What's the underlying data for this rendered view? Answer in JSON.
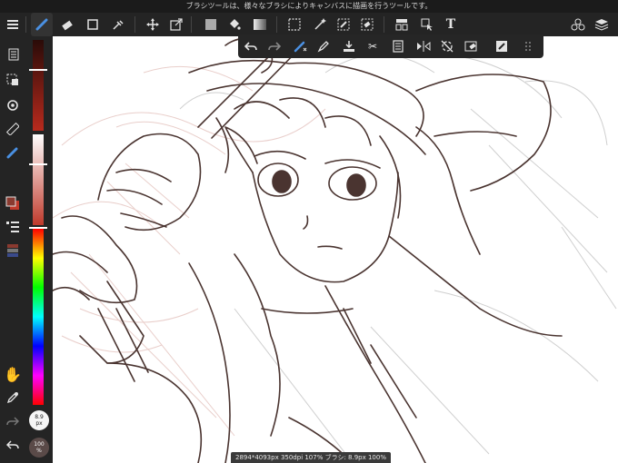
{
  "hint_text": "ブラシツールは、様々なブラシによりキャンバスに描画を行うツールです。",
  "colors": {
    "primary": "#8a3a30",
    "secondary": "#c0392b",
    "toolbar_bg": "#242424",
    "accent": "#4a90e2"
  },
  "toolbar": {
    "items": [
      "menu-icon",
      "brush-icon",
      "eraser-icon",
      "shape-icon",
      "smudge-icon",
      "move-icon",
      "transform-icon",
      "fill-color-icon",
      "bucket-icon",
      "gradient-icon",
      "select-icon",
      "magic-wand-icon",
      "select-pen-icon",
      "select-eraser-icon",
      "frame-icon",
      "operation-icon",
      "text-icon",
      "materials-icon",
      "layers-icon"
    ]
  },
  "sub_toolbar": {
    "items": [
      "undo-icon",
      "redo-icon",
      "brush-adjust-icon",
      "pen-icon",
      "paste-icon",
      "cut-icon",
      "copy-icon",
      "flip-icon",
      "rotate-icon",
      "clear-icon",
      "edit-icon",
      "grip-icon"
    ]
  },
  "left_panel": {
    "brush_size": "8.9",
    "brush_size_unit": "px",
    "opacity": "100",
    "opacity_unit": "%",
    "size_slider_level": 0.55,
    "opacity_slider_level": 0.15
  },
  "status": {
    "text": "2894*4093px 350dpi 107% ブラシ: 8.9px 100%"
  }
}
